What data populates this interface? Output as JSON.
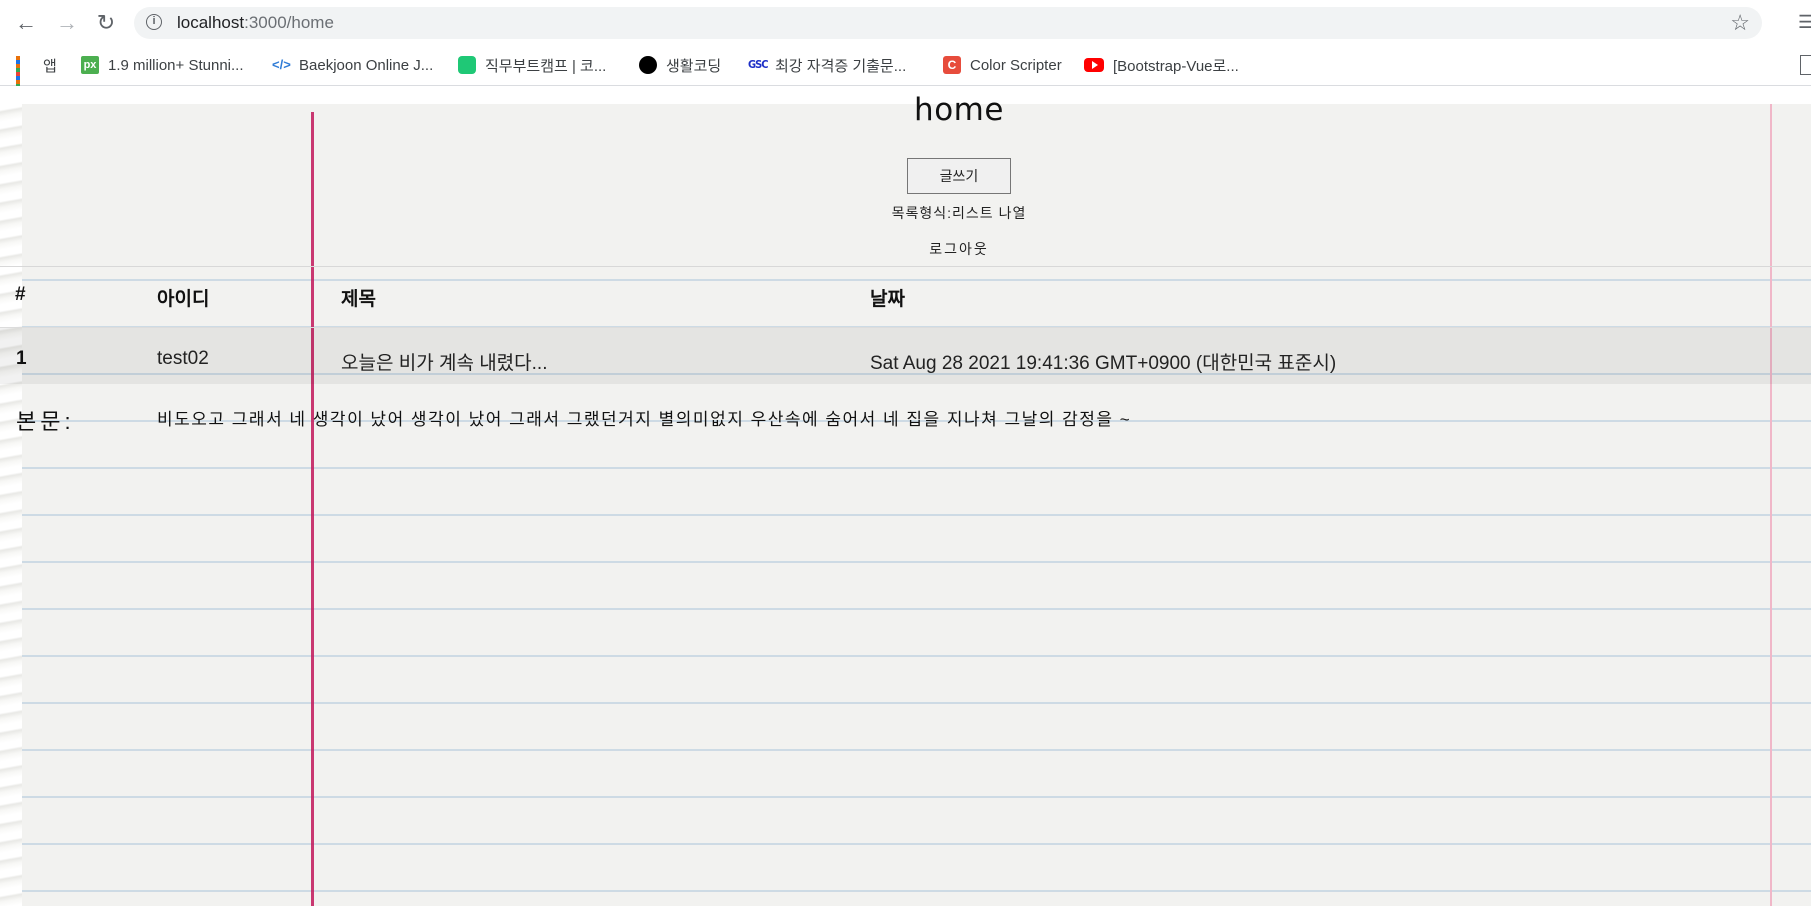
{
  "browser": {
    "url_host": "localhost",
    "url_path": ":3000/home",
    "bookmarks": [
      {
        "label": "앱",
        "icon": "apps-icon"
      },
      {
        "label": "1.9 million+ Stunni...",
        "icon": "px-icon"
      },
      {
        "label": "Baekjoon Online J...",
        "icon": "baekjoon-icon"
      },
      {
        "label": "직무부트캠프 | 코...",
        "icon": "bootcamp-icon"
      },
      {
        "label": "생활코딩",
        "icon": "circle-icon"
      },
      {
        "label": "최강 자격증 기출문...",
        "icon": "gsc-icon"
      },
      {
        "label": "Color Scripter",
        "icon": "color-scripter-icon"
      },
      {
        "label": "[Bootstrap-Vue로...",
        "icon": "youtube-icon"
      }
    ],
    "icon_text": {
      "px": "px",
      "bj": "</>",
      "gsc": "GSC",
      "cs": "C"
    }
  },
  "page": {
    "title": "home",
    "write_button": "글쓰기",
    "list_mode": "목록형식:리스트 나열",
    "logout": "로그아웃"
  },
  "table": {
    "headers": [
      "#",
      "아이디",
      "제목",
      "날짜"
    ],
    "rows": [
      {
        "num": "1",
        "id": "test02",
        "title": "오늘은 비가 계속 내렸다...",
        "date": "Sat Aug 28 2021 19:41:36 GMT+0900 (대한민국 표준시)"
      }
    ],
    "body_label": "본문:",
    "body_text": "비도오고 그래서 네 생각이 났어 생각이 났어 그래서 그랬던거지 별의미없지 우산속에 숨어서 네 집을 지나쳐 그날의 감정을 ~"
  },
  "colors": {
    "margin_line": "#c2185b",
    "rule_line": "#a9c3d9"
  }
}
